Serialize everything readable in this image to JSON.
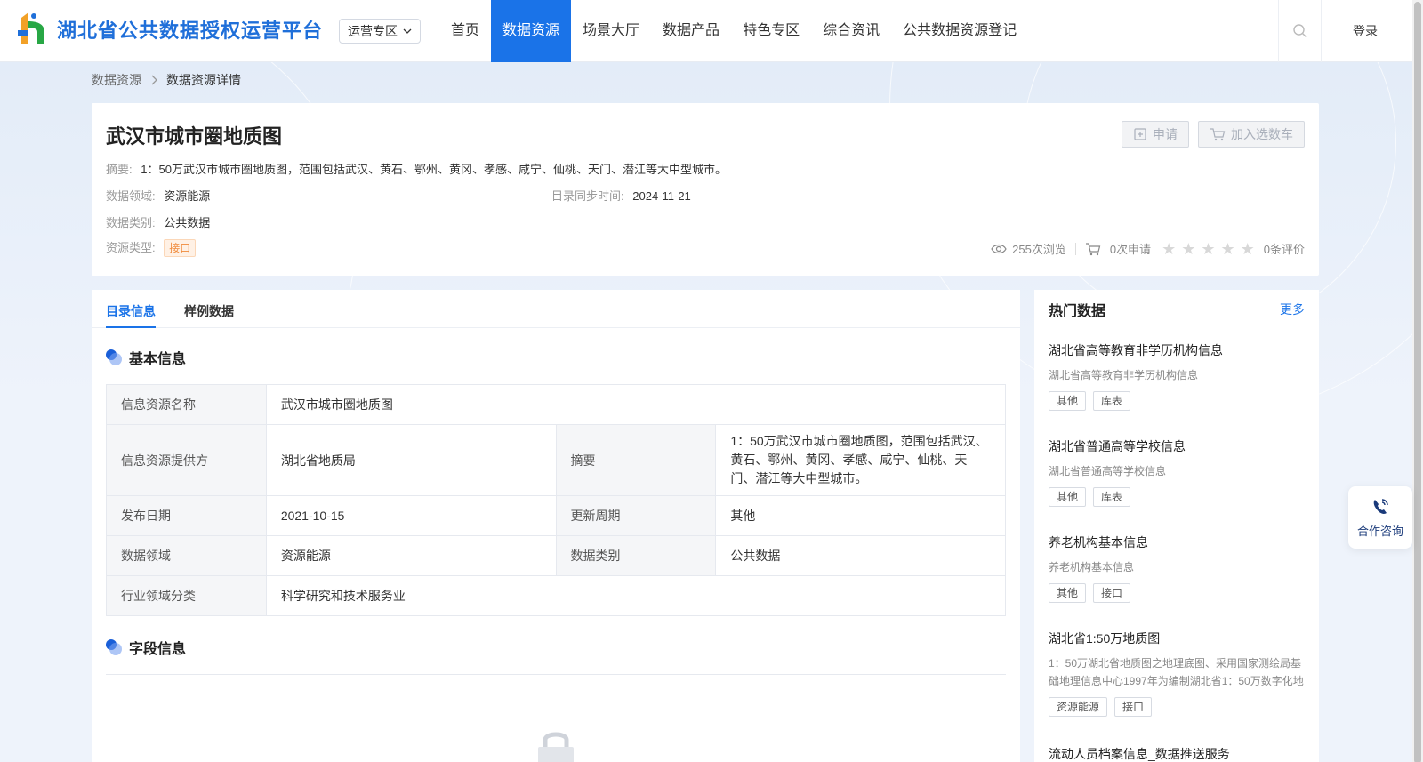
{
  "header": {
    "logo_text": "湖北省公共数据授权运营平台",
    "zone_select": "运营专区",
    "nav": [
      "首页",
      "数据资源",
      "场景大厅",
      "数据产品",
      "特色专区",
      "综合资讯",
      "公共数据资源登记"
    ],
    "active_nav": "数据资源",
    "login": "登录"
  },
  "breadcrumb": {
    "parent": "数据资源",
    "separator": ">",
    "current": "数据资源详情"
  },
  "summary": {
    "title": "武汉市城市圈地质图",
    "apply_btn": "申请",
    "cart_btn": "加入选数车",
    "abstract_label": "摘要:",
    "abstract": "1：50万武汉市城市圈地质图，范围包括武汉、黄石、鄂州、黄冈、孝感、咸宁、仙桃、天门、潜江等大中型城市。",
    "domain_label": "数据领域:",
    "domain": "资源能源",
    "sync_label": "目录同步时间:",
    "sync_time": "2024-11-21",
    "category_label": "数据类别:",
    "category": "公共数据",
    "type_label": "资源类型:",
    "type": "接口",
    "views": "255次浏览",
    "applies": "0次申请",
    "reviews": "0条评价",
    "rating": 0,
    "rating_max": 5
  },
  "tabs": [
    "目录信息",
    "样例数据"
  ],
  "basic": {
    "title": "基本信息",
    "rows": {
      "name_k": "信息资源名称",
      "name_v": "武汉市城市圈地质图",
      "provider_k": "信息资源提供方",
      "provider_v": "湖北省地质局",
      "abstract_k": "摘要",
      "abstract_v": "1：50万武汉市城市圈地质图，范围包括武汉、黄石、鄂州、黄冈、孝感、咸宁、仙桃、天门、潜江等大中型城市。",
      "pub_k": "发布日期",
      "pub_v": "2021-10-15",
      "cycle_k": "更新周期",
      "cycle_v": "其他",
      "domain_k": "数据领域",
      "domain_v": "资源能源",
      "cat_k": "数据类别",
      "cat_v": "公共数据",
      "industry_k": "行业领域分类",
      "industry_v": "科学研究和技术服务业"
    }
  },
  "fields": {
    "title": "字段信息"
  },
  "hot": {
    "title": "热门数据",
    "more": "更多",
    "items": [
      {
        "title": "湖北省高等教育非学历机构信息",
        "desc": "湖北省高等教育非学历机构信息",
        "tags": [
          "其他",
          "库表"
        ]
      },
      {
        "title": "湖北省普通高等学校信息",
        "desc": "湖北省普通高等学校信息",
        "tags": [
          "其他",
          "库表"
        ]
      },
      {
        "title": "养老机构基本信息",
        "desc": "养老机构基本信息",
        "tags": [
          "其他",
          "接口"
        ]
      },
      {
        "title": "湖北省1:50万地质图",
        "desc": "1：50万湖北省地质图之地理底图、采用国家测绘局基础地理信息中心1997年为编制湖北省1：50万数字化地",
        "tags": [
          "资源能源",
          "接口"
        ]
      },
      {
        "title": "流动人员档案信息_数据推送服务",
        "desc": "",
        "tags": []
      }
    ]
  },
  "consult": "合作咨询",
  "colors": {
    "primary": "#1a73e8",
    "api_tag": "#f08b3c"
  },
  "icons": [
    "logo-icon",
    "chevron-down-icon",
    "search-icon",
    "chevron-right-icon",
    "apply-icon",
    "cart-icon",
    "eye-icon",
    "star-icon",
    "dot-icon",
    "lock-icon",
    "phone-icon"
  ]
}
